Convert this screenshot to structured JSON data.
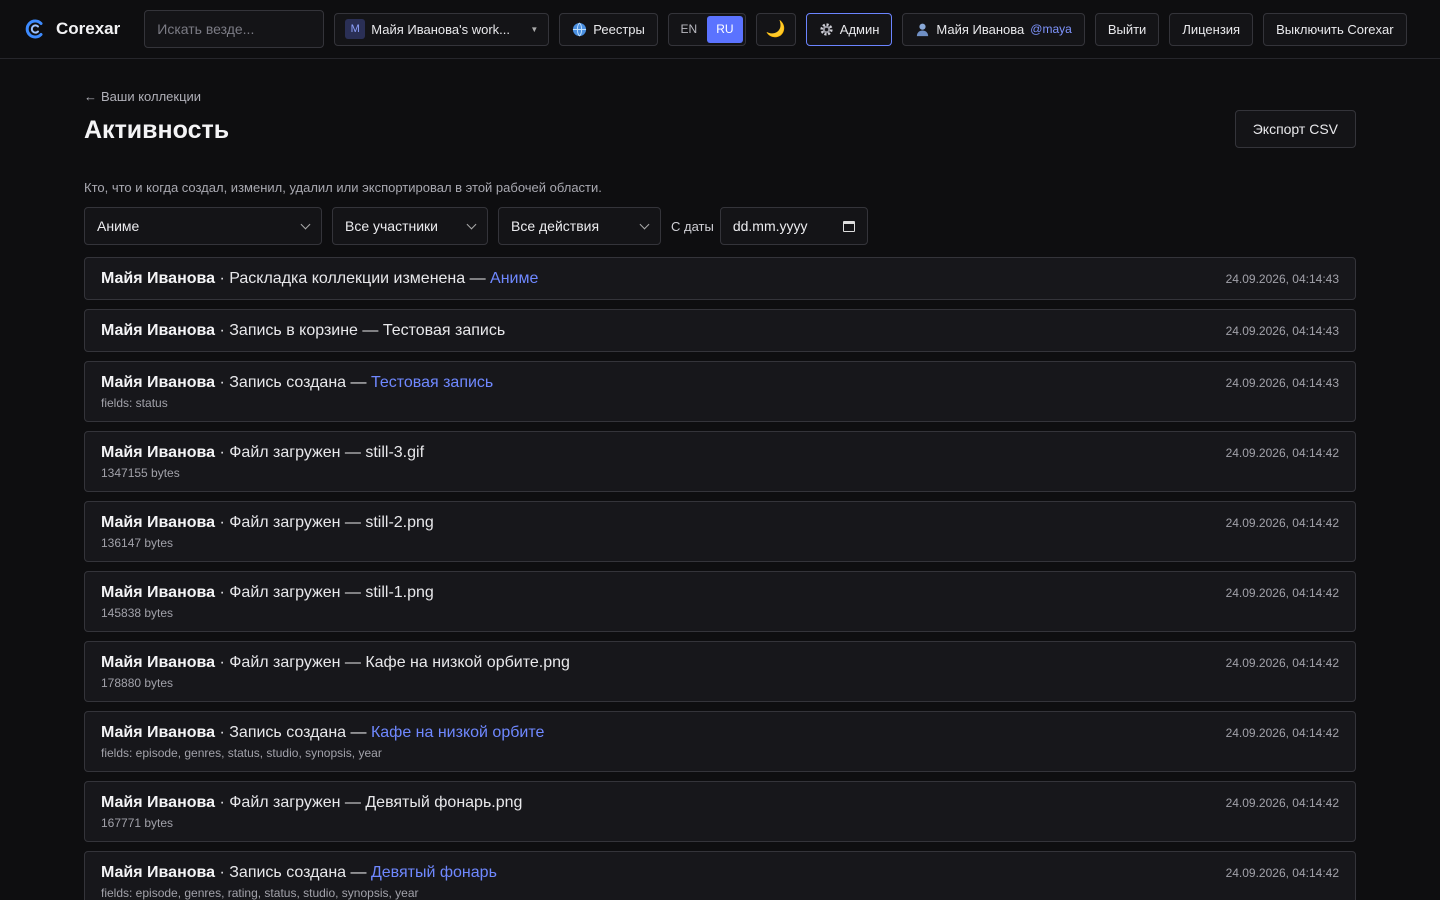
{
  "header": {
    "brand": "Corexar",
    "search_placeholder": "Искать везде...",
    "workspace_badge": "M",
    "workspace_name": "Майя Иванова's work...",
    "registries_label": "Реестры",
    "lang_en": "EN",
    "lang_ru": "RU",
    "theme_icon": "🌙",
    "admin_label": "Админ",
    "user_name": "Майя Иванова",
    "user_handle": "@maya",
    "logout_label": "Выйти",
    "license_label": "Лицензия",
    "shutdown_label": "Выключить Corexar"
  },
  "page": {
    "back_label": "Ваши коллекции",
    "title": "Активность",
    "export_label": "Экспорт CSV",
    "description": "Кто, что и когда создал, изменил, удалил или экспортировал в этой рабочей области."
  },
  "filters": {
    "collection": "Аниме",
    "members": "Все участники",
    "actions": "Все действия",
    "since_label": "С даты",
    "date_placeholder": "dd.mm.yyyy"
  },
  "activity": [
    {
      "actor": "Майя Иванова",
      "action": "Раскладка коллекции изменена — ",
      "target": "Аниме",
      "target_link": true,
      "detail": "",
      "time": "24.09.2026, 04:14:43"
    },
    {
      "actor": "Майя Иванова",
      "action": "Запись в корзине — Тестовая запись",
      "target": "",
      "target_link": false,
      "detail": "",
      "time": "24.09.2026, 04:14:43"
    },
    {
      "actor": "Майя Иванова",
      "action": "Запись создана — ",
      "target": "Тестовая запись",
      "target_link": true,
      "detail": "fields: status",
      "time": "24.09.2026, 04:14:43"
    },
    {
      "actor": "Майя Иванова",
      "action": "Файл загружен — still-3.gif",
      "target": "",
      "target_link": false,
      "detail": "1347155 bytes",
      "time": "24.09.2026, 04:14:42"
    },
    {
      "actor": "Майя Иванова",
      "action": "Файл загружен — still-2.png",
      "target": "",
      "target_link": false,
      "detail": "136147 bytes",
      "time": "24.09.2026, 04:14:42"
    },
    {
      "actor": "Майя Иванова",
      "action": "Файл загружен — still-1.png",
      "target": "",
      "target_link": false,
      "detail": "145838 bytes",
      "time": "24.09.2026, 04:14:42"
    },
    {
      "actor": "Майя Иванова",
      "action": "Файл загружен — Кафе на низкой орбите.png",
      "target": "",
      "target_link": false,
      "detail": "178880 bytes",
      "time": "24.09.2026, 04:14:42"
    },
    {
      "actor": "Майя Иванова",
      "action": "Запись создана — ",
      "target": "Кафе на низкой орбите",
      "target_link": true,
      "detail": "fields: episode, genres, status, studio, synopsis, year",
      "time": "24.09.2026, 04:14:42"
    },
    {
      "actor": "Майя Иванова",
      "action": "Файл загружен — Девятый фонарь.png",
      "target": "",
      "target_link": false,
      "detail": "167771 bytes",
      "time": "24.09.2026, 04:14:42"
    },
    {
      "actor": "Майя Иванова",
      "action": "Запись создана — ",
      "target": "Девятый фонарь",
      "target_link": true,
      "detail": "fields: episode, genres, rating, status, studio, synopsis, year",
      "time": "24.09.2026, 04:14:42"
    }
  ],
  "colors": {
    "accent": "#5b73ff",
    "link": "#6f88ff",
    "background": "#0e0e10"
  }
}
